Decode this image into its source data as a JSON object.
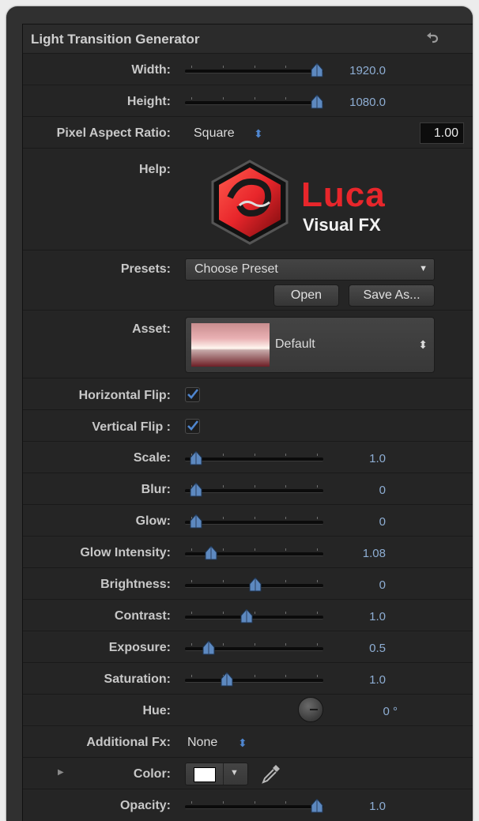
{
  "header": {
    "title": "Light Transition Generator",
    "reset_icon": "reset-arrow-icon"
  },
  "width": {
    "label": "Width:",
    "value": "1920.0",
    "level": 1.0
  },
  "height": {
    "label": "Height:",
    "value": "1080.0",
    "level": 1.0
  },
  "pixel_aspect": {
    "label": "Pixel Aspect Ratio:",
    "selected": "Square",
    "stepper": "⬍",
    "value": "1.00"
  },
  "help": {
    "label": "Help:",
    "logo_text": "Luca",
    "logo_sub": "Visual FX"
  },
  "presets": {
    "label": "Presets:",
    "selected": "Choose Preset",
    "arrow": "▼",
    "open_label": "Open",
    "save_as_label": "Save As..."
  },
  "asset": {
    "label": "Asset:",
    "selected": "Default",
    "stepper": "⬍"
  },
  "horizontal_flip": {
    "label": "Horizontal Flip:",
    "checked": true
  },
  "vertical_flip": {
    "label": "Vertical Flip :",
    "checked": true
  },
  "sliders": [
    {
      "key": "scale",
      "label": "Scale:",
      "value": "1.0",
      "level": 0.04
    },
    {
      "key": "blur",
      "label": "Blur:",
      "value": "0",
      "level": 0.04
    },
    {
      "key": "glow",
      "label": "Glow:",
      "value": "0",
      "level": 0.04
    },
    {
      "key": "glow-intensity",
      "label": "Glow Intensity:",
      "value": "1.08",
      "level": 0.16
    },
    {
      "key": "brightness",
      "label": "Brightness:",
      "value": "0",
      "level": 0.51
    },
    {
      "key": "contrast",
      "label": "Contrast:",
      "value": "1.0",
      "level": 0.44
    },
    {
      "key": "exposure",
      "label": "Exposure:",
      "value": "0.5",
      "level": 0.14
    },
    {
      "key": "saturation",
      "label": "Saturation:",
      "value": "1.0",
      "level": 0.28
    }
  ],
  "hue": {
    "label": "Hue:",
    "value": "0 °"
  },
  "additional_fx": {
    "label": "Additional Fx:",
    "selected": "None",
    "stepper": "⬍"
  },
  "color": {
    "label": "Color:",
    "swatch": "#ffffff",
    "disclosure": "▶",
    "arrow": "▼"
  },
  "opacity": {
    "label": "Opacity:",
    "value": "1.0",
    "level": 1.0
  },
  "colors": {
    "accent": "#4f86cf",
    "value_text": "#8eaed4",
    "logo_red": "#e8262b"
  }
}
